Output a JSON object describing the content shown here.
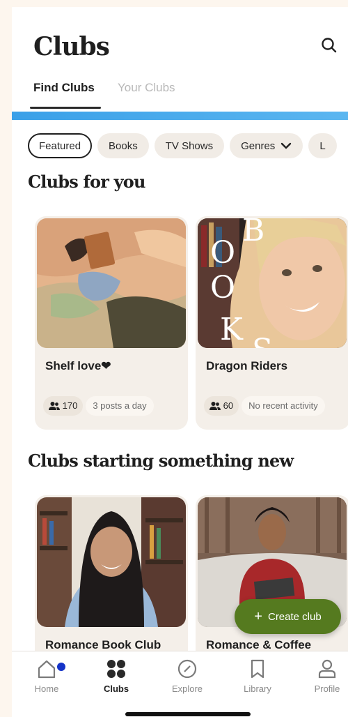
{
  "header": {
    "title": "Clubs",
    "search_icon": "search-icon"
  },
  "tabs": [
    {
      "label": "Find Clubs",
      "active": true
    },
    {
      "label": "Your Clubs",
      "active": false
    }
  ],
  "filters": [
    {
      "label": "Featured",
      "selected": true
    },
    {
      "label": "Books",
      "selected": false
    },
    {
      "label": "TV Shows",
      "selected": false
    },
    {
      "label": "Genres",
      "selected": false,
      "icon": "chevron-down-icon"
    },
    {
      "label": "L",
      "selected": false
    }
  ],
  "sections": {
    "for_you": {
      "title": "Clubs for you",
      "clubs": [
        {
          "name": "Shelf love❤",
          "members": "170",
          "activity": "3 posts a day"
        },
        {
          "name": "Dragon Riders",
          "members": "60",
          "activity": "No recent activity",
          "image_text": [
            "B",
            "O",
            "O",
            "K",
            "S"
          ]
        }
      ]
    },
    "starting_new": {
      "title": "Clubs starting something new",
      "clubs": [
        {
          "name": "Romance Book Club"
        },
        {
          "name": "Romance & Coffee"
        }
      ]
    }
  },
  "fab": {
    "label": "Create club",
    "icon": "plus-icon",
    "color": "#557a1f"
  },
  "nav": [
    {
      "label": "Home",
      "icon": "home-icon",
      "badge": true
    },
    {
      "label": "Clubs",
      "icon": "clubs-icon",
      "active": true
    },
    {
      "label": "Explore",
      "icon": "compass-icon"
    },
    {
      "label": "Library",
      "icon": "bookmark-icon"
    },
    {
      "label": "Profile",
      "icon": "user-icon"
    }
  ],
  "colors": {
    "accent_bar": "#3aa0e8",
    "badge": "#1433c8",
    "card_bg": "#f4efe9",
    "page_bg": "#fdf6ee"
  }
}
